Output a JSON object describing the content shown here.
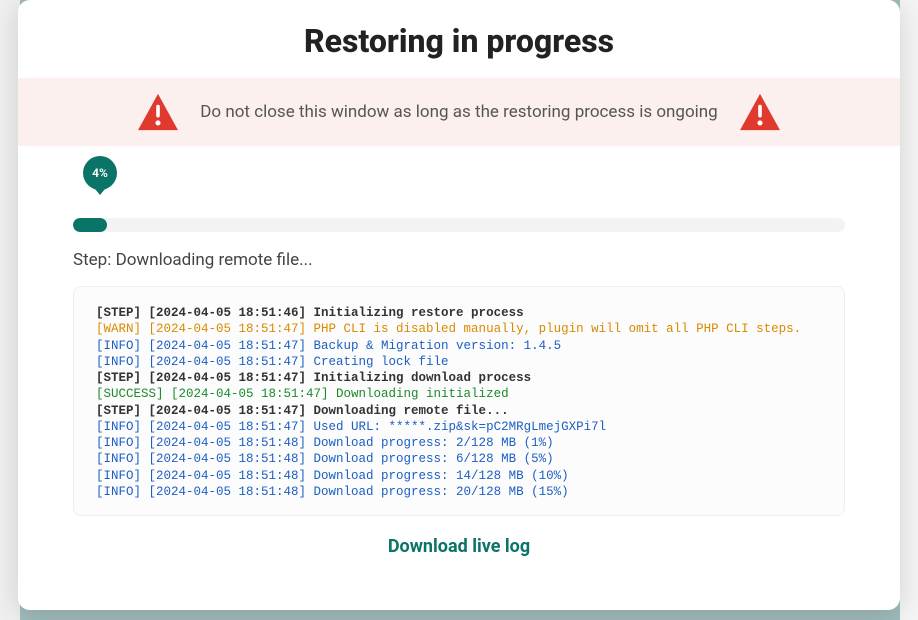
{
  "modal": {
    "title": "Restoring in progress",
    "warning_message": "Do not close this window as long as the restoring process is ongoing",
    "progress_pct": "4%",
    "step_prefix": "Step: ",
    "step_text": "Downloading remote file...",
    "download_link_label": "Download live log"
  },
  "log": [
    {
      "level": "STEP",
      "ts": "[2024-04-05 18:51:46]",
      "msg": "Initializing restore process"
    },
    {
      "level": "WARN",
      "ts": "[2024-04-05 18:51:47]",
      "msg": "PHP CLI is disabled manually, plugin will omit all PHP CLI steps."
    },
    {
      "level": "INFO",
      "ts": "[2024-04-05 18:51:47]",
      "msg": "Backup & Migration version: 1.4.5"
    },
    {
      "level": "INFO",
      "ts": "[2024-04-05 18:51:47]",
      "msg": "Creating lock file"
    },
    {
      "level": "STEP",
      "ts": "[2024-04-05 18:51:47]",
      "msg": "Initializing download process"
    },
    {
      "level": "SUCCESS",
      "ts": "[2024-04-05 18:51:47]",
      "msg": "Downloading initialized"
    },
    {
      "level": "STEP",
      "ts": "[2024-04-05 18:51:47]",
      "msg": "Downloading remote file..."
    },
    {
      "level": "INFO",
      "ts": "[2024-04-05 18:51:47]",
      "msg": "Used URL: *****.zip&sk=pC2MRgLmejGXPi7l"
    },
    {
      "level": "INFO",
      "ts": "[2024-04-05 18:51:48]",
      "msg": "Download progress: 2/128 MB (1%)"
    },
    {
      "level": "INFO",
      "ts": "[2024-04-05 18:51:48]",
      "msg": "Download progress: 6/128 MB (5%)"
    },
    {
      "level": "INFO",
      "ts": "[2024-04-05 18:51:48]",
      "msg": "Download progress: 14/128 MB (10%)"
    },
    {
      "level": "INFO",
      "ts": "[2024-04-05 18:51:48]",
      "msg": "Download progress: 20/128 MB (15%)"
    }
  ],
  "colors": {
    "accent": "#0b7468",
    "warn_bg": "#fcf0ef",
    "warn_icon": "#e0392d"
  }
}
